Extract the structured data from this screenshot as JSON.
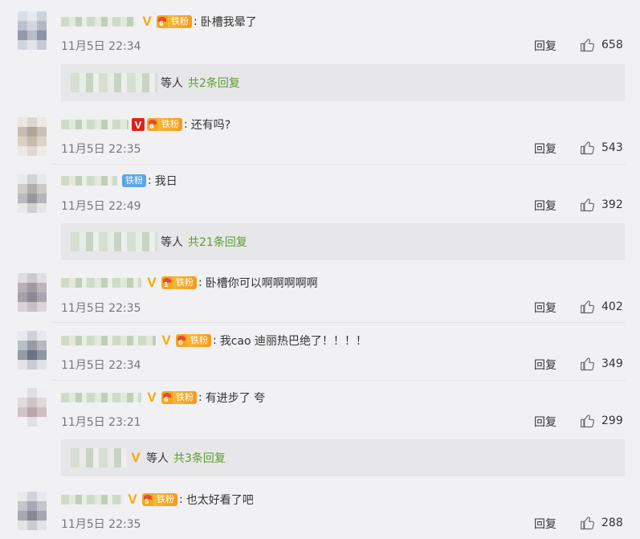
{
  "comments": [
    {
      "text": "卧槽我晕了",
      "time": "11月5日 22:34",
      "reply": "回复",
      "likes": "658",
      "fan_label": "铁粉",
      "fan_level": "6"
    },
    {
      "text": "还有吗?",
      "time": "11月5日 22:35",
      "reply": "回复",
      "likes": "543",
      "fan_label": "铁粉",
      "fan_level": "6"
    },
    {
      "text": "我日",
      "time": "11月5日 22:49",
      "reply": "回复",
      "likes": "392",
      "fan_label": "铁粉"
    },
    {
      "text": "卧槽你可以啊啊啊啊啊",
      "time": "11月5日 22:35",
      "reply": "回复",
      "likes": "402",
      "fan_label": "铁粉",
      "fan_level": "1"
    },
    {
      "text": "我cao  迪丽热巴绝了！！！！",
      "time": "11月5日 22:34",
      "reply": "回复",
      "likes": "349",
      "fan_label": "铁粉",
      "fan_level": "6"
    },
    {
      "text": "有进步了 夸",
      "time": "11月5日 23:21",
      "reply": "回复",
      "likes": "299",
      "fan_label": "铁粉",
      "fan_level": "6"
    },
    {
      "text": "也太好看了吧",
      "time": "11月5日 22:35",
      "reply": "回复",
      "likes": "288",
      "fan_label": "铁粉",
      "fan_level": "5"
    }
  ],
  "reply_bars": [
    {
      "deng": "等人",
      "total": "共2条回复"
    },
    {
      "deng": "等人",
      "total": "共21条回复"
    },
    {
      "deng": "等人",
      "total": "共3条回复"
    }
  ],
  "colors": {
    "accent_green": "#5a9d2a",
    "verified": "#f7a800",
    "fan_orange": "#f39a1e",
    "fan_blue": "#5aa5e8"
  },
  "icons": {
    "like": "thumbs-up-icon",
    "verified": "verified-v-icon",
    "fan": "fan-badge-icon"
  }
}
